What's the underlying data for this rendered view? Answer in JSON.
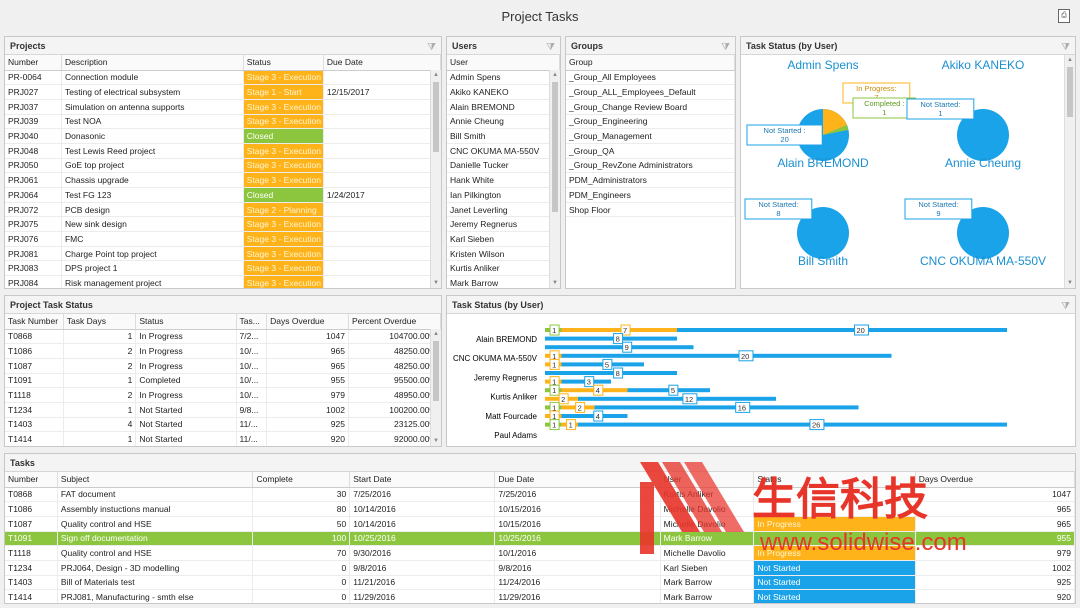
{
  "window": {
    "title": "Project Tasks"
  },
  "projects": {
    "title": "Projects",
    "columns": [
      "Number",
      "Description",
      "Status",
      "Due Date"
    ],
    "rows": [
      {
        "number": "PR-0064",
        "desc": "Connection module",
        "status": "Stage 3 - Execution",
        "cls": "st-exec",
        "due": ""
      },
      {
        "number": "PRJ027",
        "desc": "Testing of electrical subsystem",
        "status": "Stage 1 - Start",
        "cls": "st-start",
        "due": "12/15/2017"
      },
      {
        "number": "PRJ037",
        "desc": "Simulation on antenna supports",
        "status": "Stage 3 - Execution",
        "cls": "st-exec",
        "due": ""
      },
      {
        "number": "PRJ039",
        "desc": "Test NOA",
        "status": "Stage 3 - Execution",
        "cls": "st-exec",
        "due": ""
      },
      {
        "number": "PRJ040",
        "desc": "Donasonic",
        "status": "Closed",
        "cls": "st-closed",
        "due": ""
      },
      {
        "number": "PRJ048",
        "desc": "Test Lewis Reed project",
        "status": "Stage 3 - Execution",
        "cls": "st-exec",
        "due": ""
      },
      {
        "number": "PRJ050",
        "desc": "GoE top project",
        "status": "Stage 3 - Execution",
        "cls": "st-exec",
        "due": ""
      },
      {
        "number": "PRJ061",
        "desc": "Chassis upgrade",
        "status": "Stage 3 - Execution",
        "cls": "st-exec",
        "due": ""
      },
      {
        "number": "PRJ064",
        "desc": "Test FG 123",
        "status": "Closed",
        "cls": "st-closed",
        "due": "1/24/2017"
      },
      {
        "number": "PRJ072",
        "desc": "PCB design",
        "status": "Stage 2 - Planning",
        "cls": "st-plan",
        "due": ""
      },
      {
        "number": "PRJ075",
        "desc": "New sink design",
        "status": "Stage 3 - Execution",
        "cls": "st-exec",
        "due": ""
      },
      {
        "number": "PRJ076",
        "desc": "FMC",
        "status": "Stage 3 - Execution",
        "cls": "st-exec",
        "due": ""
      },
      {
        "number": "PRJ081",
        "desc": "Charge Point top project",
        "status": "Stage 3 - Execution",
        "cls": "st-exec",
        "due": ""
      },
      {
        "number": "PRJ083",
        "desc": "DPS project 1",
        "status": "Stage 3 - Execution",
        "cls": "st-exec",
        "due": ""
      },
      {
        "number": "PRJ084",
        "desc": "Risk management project",
        "status": "Stage 3 - Execution",
        "cls": "st-exec",
        "due": ""
      }
    ]
  },
  "users": {
    "title": "Users",
    "column": "User",
    "rows": [
      "Admin Spens",
      "Akiko KANEKO",
      "Alain BREMOND",
      "Annie Cheung",
      "Bill Smith",
      "CNC OKUMA MA-550V",
      "Danielle Tucker",
      "Hank White",
      "Ian Pilkington",
      "Janet Leverling",
      "Jeremy Regnerus",
      "Karl Sieben",
      "Kristen Wilson",
      "Kurtis Anliker",
      "Mark Barrow"
    ]
  },
  "groups": {
    "title": "Groups",
    "column": "Group",
    "rows": [
      "_Group_All Employees",
      "_Group_ALL_Employees_Default",
      "_Group_Change Review Board",
      "_Group_Engineering",
      "_Group_Management",
      "_Group_QA",
      "_Group_RevZone Administrators",
      "PDM_Administrators",
      "PDM_Engineers",
      "Shop Floor"
    ]
  },
  "task_status_pies": {
    "title": "Task Status (by User)",
    "users": [
      {
        "name": "Admin Spens",
        "labels": [
          "In Progress: 7",
          "Completed : 1",
          "Not Started : 20"
        ]
      },
      {
        "name": "Akiko KANEKO",
        "labels": [
          "Not Started: 1"
        ]
      },
      {
        "name": "Alain BREMOND",
        "labels": [
          "Not Started: 8"
        ]
      },
      {
        "name": "Annie Cheung",
        "labels": [
          "Not Started: 9"
        ]
      },
      {
        "name": "Bill Smith",
        "labels": []
      },
      {
        "name": "CNC OKUMA MA-550V",
        "labels": []
      }
    ]
  },
  "project_task_status": {
    "title": "Project Task Status",
    "columns": [
      "Task Number",
      "Task Days",
      "Status",
      "Tas...",
      "Days Overdue",
      "Percent Overdue"
    ],
    "rows": [
      {
        "num": "T0868",
        "days": "1",
        "status": "In Progress",
        "tas": "7/2...",
        "over": "1047",
        "pct": "104700.00%"
      },
      {
        "num": "T1086",
        "days": "2",
        "status": "In Progress",
        "tas": "10/...",
        "over": "965",
        "pct": "48250.00%"
      },
      {
        "num": "T1087",
        "days": "2",
        "status": "In Progress",
        "tas": "10/...",
        "over": "965",
        "pct": "48250.00%"
      },
      {
        "num": "T1091",
        "days": "1",
        "status": "Completed",
        "tas": "10/...",
        "over": "955",
        "pct": "95500.00%"
      },
      {
        "num": "T1118",
        "days": "2",
        "status": "In Progress",
        "tas": "10/...",
        "over": "979",
        "pct": "48950.00%"
      },
      {
        "num": "T1234",
        "days": "1",
        "status": "Not Started",
        "tas": "9/8...",
        "over": "1002",
        "pct": "100200.00%"
      },
      {
        "num": "T1403",
        "days": "4",
        "status": "Not Started",
        "tas": "11/...",
        "over": "925",
        "pct": "23125.00%"
      },
      {
        "num": "T1414",
        "days": "1",
        "status": "Not Started",
        "tas": "11/...",
        "over": "920",
        "pct": "92000.00%"
      }
    ]
  },
  "bar_chart": {
    "title": "Task Status (by User)",
    "labels": [
      "Alain BREMOND",
      "CNC OKUMA MA-550V",
      "Jeremy Regnerus",
      "Kurtis Anliker",
      "Matt Fourcade",
      "Paul Adams"
    ]
  },
  "chart_data": {
    "type": "bar",
    "title": "Task Status (by User)",
    "categories": [
      "Alain BREMOND",
      "CNC OKUMA MA-550V",
      "Jeremy Regnerus",
      "Kurtis Anliker",
      "Matt Fourcade",
      "Paul Adams"
    ],
    "rows": [
      [
        {
          "c": "#8cc63f",
          "v": 1
        },
        {
          "c": "#ffb31a",
          "v": 7
        },
        {
          "c": "#1aa3e8",
          "v": 20
        }
      ],
      [
        {
          "c": "#1aa3e8",
          "v": 8
        }
      ],
      [
        {
          "c": "#1aa3e8",
          "v": 9
        }
      ],
      [
        {
          "c": "#ffb31a",
          "v": 1
        },
        {
          "c": "#1aa3e8",
          "v": 20
        }
      ],
      [
        {
          "c": "#ffb31a",
          "v": 1
        },
        {
          "c": "#1aa3e8",
          "v": 5
        }
      ],
      [
        {
          "c": "#1aa3e8",
          "v": 8
        }
      ],
      [
        {
          "c": "#ffb31a",
          "v": 1
        },
        {
          "c": "#1aa3e8",
          "v": 3
        }
      ],
      [
        {
          "c": "#8cc63f",
          "v": 1
        },
        {
          "c": "#ffb31a",
          "v": 4
        },
        {
          "c": "#1aa3e8",
          "v": 5
        }
      ],
      [
        {
          "c": "#ffb31a",
          "v": 2
        },
        {
          "c": "#1aa3e8",
          "v": 12
        }
      ],
      [
        {
          "c": "#8cc63f",
          "v": 1
        },
        {
          "c": "#ffb31a",
          "v": 2
        },
        {
          "c": "#1aa3e8",
          "v": 16
        }
      ],
      [
        {
          "c": "#ffb31a",
          "v": 1
        },
        {
          "c": "#1aa3e8",
          "v": 4
        }
      ],
      [
        {
          "c": "#8cc63f",
          "v": 1
        },
        {
          "c": "#ffb31a",
          "v": 1
        },
        {
          "c": "#1aa3e8",
          "v": 26
        }
      ]
    ]
  },
  "tasks": {
    "title": "Tasks",
    "columns": [
      "Number",
      "Subject",
      "Complete",
      "Start Date",
      "Due Date",
      "User",
      "Status",
      "Days Overdue"
    ],
    "rows": [
      {
        "num": "T0868",
        "subj": "FAT document",
        "comp": "30",
        "start": "7/25/2016",
        "due": "7/25/2016",
        "user": "Kurtis Anliker",
        "status": "",
        "cls": "",
        "over": "1047"
      },
      {
        "num": "T1086",
        "subj": "Assembly instuctions manual",
        "comp": "80",
        "start": "10/14/2016",
        "due": "10/15/2016",
        "user": "Michelle Davolio",
        "status": "",
        "cls": "",
        "over": "965"
      },
      {
        "num": "T1087",
        "subj": "Quality control and HSE",
        "comp": "50",
        "start": "10/14/2016",
        "due": "10/15/2016",
        "user": "Michelle Davolio",
        "status": "In Progress",
        "cls": "st-ip",
        "over": "965"
      },
      {
        "num": "T1091",
        "subj": "Sign off documentation",
        "comp": "100",
        "start": "10/25/2016",
        "due": "10/25/2016",
        "user": "Mark Barrow",
        "status": "",
        "cls": "",
        "over": "955",
        "sel": true
      },
      {
        "num": "T1118",
        "subj": "Quality control and HSE",
        "comp": "70",
        "start": "9/30/2016",
        "due": "10/1/2016",
        "user": "Michelle Davolio",
        "status": "In Progress",
        "cls": "st-ip",
        "over": "979"
      },
      {
        "num": "T1234",
        "subj": "PRJ064, Design - 3D modelling",
        "comp": "0",
        "start": "9/8/2016",
        "due": "9/8/2016",
        "user": "Karl Sieben",
        "status": "Not Started",
        "cls": "st-ns",
        "over": "1002"
      },
      {
        "num": "T1403",
        "subj": "Bill of Materials test",
        "comp": "0",
        "start": "11/21/2016",
        "due": "11/24/2016",
        "user": "Mark Barrow",
        "status": "Not Started",
        "cls": "st-ns",
        "over": "925"
      },
      {
        "num": "T1414",
        "subj": "PRJ081, Manufacturing - smth else",
        "comp": "0",
        "start": "11/29/2016",
        "due": "11/29/2016",
        "user": "Mark Barrow",
        "status": "Not Started",
        "cls": "st-ns",
        "over": "920"
      }
    ]
  },
  "watermark": {
    "cn": "生信科技",
    "url": "www.solidwise.com"
  }
}
